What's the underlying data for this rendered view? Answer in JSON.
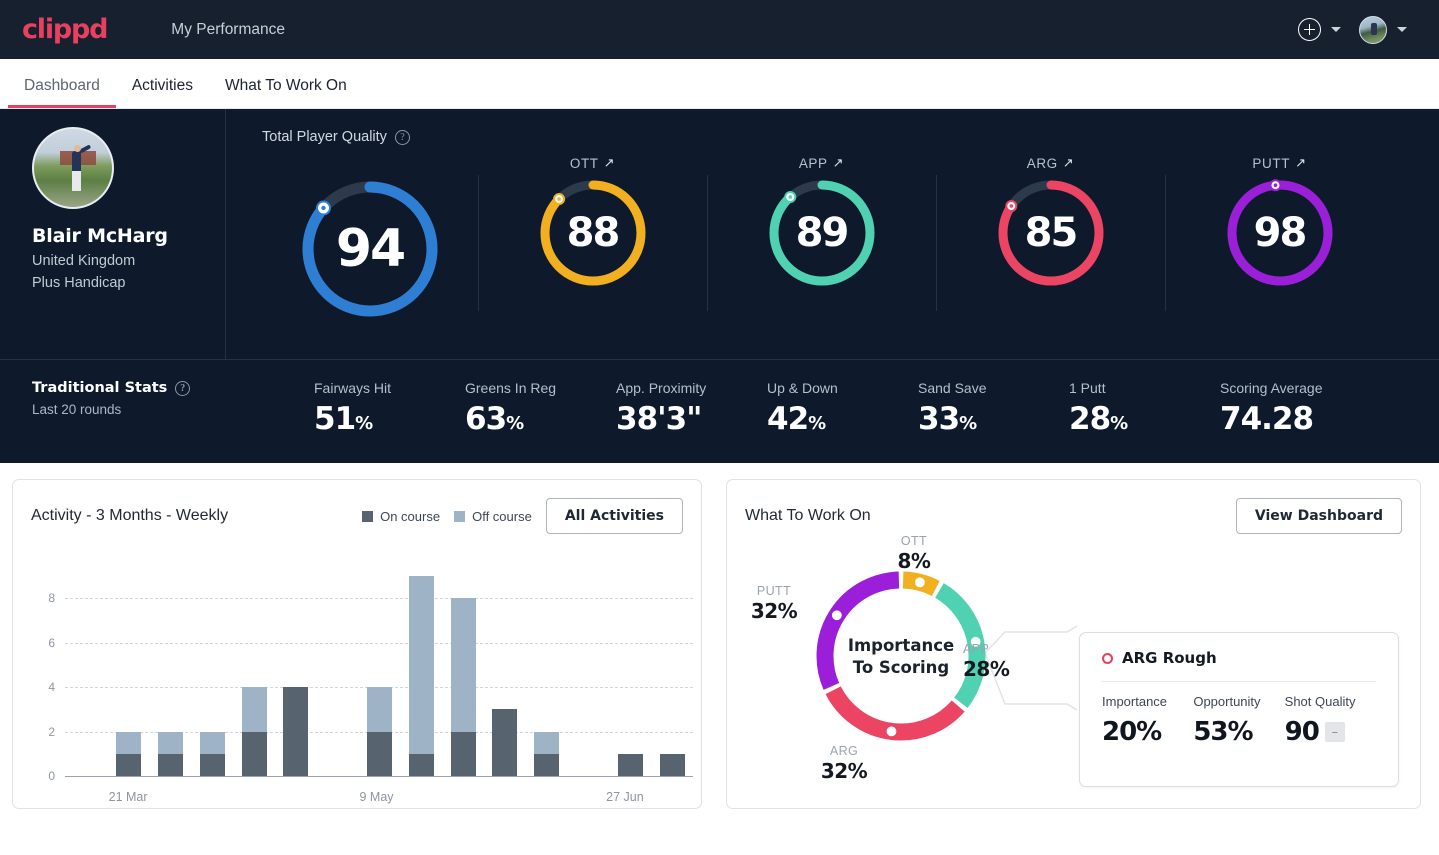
{
  "topbar": {
    "logo": "clippd",
    "title": "My Performance",
    "add_icon": "plus-circle-icon",
    "add_chevron": "chevron-down-icon",
    "avatar": "user-avatar",
    "avatar_chevron": "chevron-down-icon"
  },
  "tabs": [
    {
      "label": "Dashboard",
      "active": true
    },
    {
      "label": "Activities",
      "active": false
    },
    {
      "label": "What To Work On",
      "active": false
    }
  ],
  "player": {
    "name": "Blair McHarg",
    "country": "United Kingdom",
    "handicap": "Plus Handicap"
  },
  "quality": {
    "section_label": "Total Player Quality",
    "help_icon": "question-circle-icon",
    "gauges": [
      {
        "title": "",
        "value": "94",
        "color": "#2e7fd4",
        "track": "#2c3a4c",
        "pct": 0.865,
        "size": "big",
        "trend": ""
      },
      {
        "title": "OTT",
        "value": "88",
        "color": "#f2b020",
        "track": "#2c3a4c",
        "pct": 0.875,
        "size": "sm",
        "trend": "↗"
      },
      {
        "title": "APP",
        "value": "89",
        "color": "#4fd1b2",
        "track": "#2c3a4c",
        "pct": 0.885,
        "size": "sm",
        "trend": "↗"
      },
      {
        "title": "ARG",
        "value": "85",
        "color": "#ec4463",
        "track": "#2c3a4c",
        "pct": 0.845,
        "size": "sm",
        "trend": "↗"
      },
      {
        "title": "PUTT",
        "value": "98",
        "color": "#9b1fd9",
        "track": "#2c3a4c",
        "pct": 0.985,
        "size": "sm",
        "trend": "↗"
      }
    ]
  },
  "traditional": {
    "title": "Traditional Stats",
    "help_icon": "question-circle-icon",
    "subtitle": "Last 20 rounds",
    "items": [
      {
        "label": "Fairways Hit",
        "value": "51",
        "unit": "%"
      },
      {
        "label": "Greens In Reg",
        "value": "63",
        "unit": "%"
      },
      {
        "label": "App. Proximity",
        "value": "38'3\"",
        "unit": ""
      },
      {
        "label": "Up & Down",
        "value": "42",
        "unit": "%"
      },
      {
        "label": "Sand Save",
        "value": "33",
        "unit": "%"
      },
      {
        "label": "1 Putt",
        "value": "28",
        "unit": "%"
      },
      {
        "label": "Scoring Average",
        "value": "74.28",
        "unit": ""
      }
    ]
  },
  "activity": {
    "title": "Activity - 3 Months - Weekly",
    "legend": [
      {
        "label": "On course",
        "color": "#57646f"
      },
      {
        "label": "Off course",
        "color": "#9fb3c6"
      }
    ],
    "button": "All Activities"
  },
  "chart_data": {
    "type": "bar",
    "title": "Activity - 3 Months - Weekly",
    "stacked": true,
    "xlabel": "",
    "ylabel": "",
    "ylim": [
      0,
      9
    ],
    "yticks": [
      0,
      2,
      4,
      6,
      8
    ],
    "grid": true,
    "legend_position": "top-right",
    "categories": [
      "w1",
      "w2",
      "w3",
      "w4",
      "w5",
      "w6",
      "w7",
      "w8",
      "w9",
      "w10",
      "w11",
      "w12",
      "w13",
      "w14",
      "w15"
    ],
    "tick_labels": [
      {
        "index": 1,
        "label": "21 Mar"
      },
      {
        "index": 7,
        "label": "9 May"
      },
      {
        "index": 13,
        "label": "27 Jun"
      }
    ],
    "series": [
      {
        "name": "On course",
        "color": "#57646f",
        "values": [
          0,
          1,
          1,
          1,
          2,
          4,
          0,
          2,
          1,
          2,
          3,
          1,
          0,
          1,
          1
        ]
      },
      {
        "name": "Off course",
        "color": "#9fb3c6",
        "values": [
          0,
          1,
          1,
          1,
          2,
          0,
          0,
          2,
          8,
          6,
          0,
          1,
          0,
          0,
          0
        ]
      }
    ]
  },
  "wtwo": {
    "title": "What To Work On",
    "button": "View Dashboard",
    "donut_center_line1": "Importance",
    "donut_center_line2": "To Scoring",
    "segments": [
      {
        "key": "OTT",
        "value": "8%",
        "color": "#f2b020",
        "pct": 8
      },
      {
        "key": "APP",
        "value": "28%",
        "color": "#4fd1b2",
        "pct": 28
      },
      {
        "key": "ARG",
        "value": "32%",
        "color": "#ec4463",
        "pct": 32
      },
      {
        "key": "PUTT",
        "value": "32%",
        "color": "#9b1fd9",
        "pct": 32
      }
    ],
    "detail": {
      "marker_icon": "circle-outline-icon",
      "title": "ARG Rough",
      "stats": [
        {
          "label": "Importance",
          "value": "20%",
          "chip": ""
        },
        {
          "label": "Opportunity",
          "value": "53%",
          "chip": ""
        },
        {
          "label": "Shot Quality",
          "value": "90",
          "chip": "–"
        }
      ]
    }
  }
}
